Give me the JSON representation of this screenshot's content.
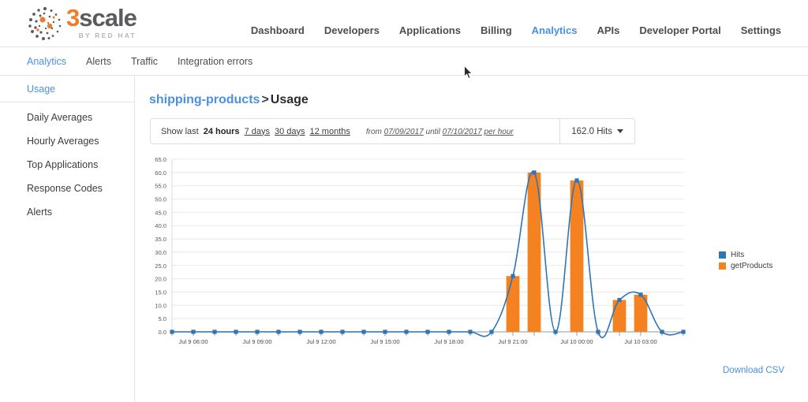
{
  "brand": {
    "name_prefix": "3",
    "name_rest": "scale",
    "tagline": "BY RED HAT",
    "logo_icon": "3scale-dots-logo"
  },
  "mainnav": {
    "items": [
      {
        "label": "Dashboard",
        "active": false
      },
      {
        "label": "Developers",
        "active": false
      },
      {
        "label": "Applications",
        "active": false
      },
      {
        "label": "Billing",
        "active": false
      },
      {
        "label": "Analytics",
        "active": true
      },
      {
        "label": "APIs",
        "active": false
      },
      {
        "label": "Developer Portal",
        "active": false
      },
      {
        "label": "Settings",
        "active": false
      }
    ]
  },
  "subnav": {
    "items": [
      {
        "label": "Analytics",
        "active": true
      },
      {
        "label": "Alerts",
        "active": false
      },
      {
        "label": "Traffic",
        "active": false
      },
      {
        "label": "Integration errors",
        "active": false
      }
    ]
  },
  "sidebar": {
    "top_item": {
      "label": "Usage",
      "active": true
    },
    "items": [
      {
        "label": "Daily Averages"
      },
      {
        "label": "Hourly Averages"
      },
      {
        "label": "Top Applications"
      },
      {
        "label": "Response Codes"
      },
      {
        "label": "Alerts"
      }
    ]
  },
  "breadcrumb": {
    "service": "shipping-products",
    "separator": ">",
    "current": "Usage"
  },
  "toolbar": {
    "show_last_label": "Show last",
    "ranges": [
      {
        "label": "24 hours",
        "selected": true
      },
      {
        "label": "7 days",
        "selected": false
      },
      {
        "label": "30 days",
        "selected": false
      },
      {
        "label": "12 months",
        "selected": false
      }
    ],
    "from_label": "from",
    "from_date": "07/09/2017",
    "until_label": "until",
    "until_date": "07/10/2017",
    "granularity": "per hour",
    "metric_value": "162.0 Hits",
    "metric_caret_icon": "chevron-down-icon"
  },
  "download": {
    "label": "Download CSV"
  },
  "colors": {
    "accent_blue": "#4a90e2",
    "series_hits": "#2e75b6",
    "series_getproducts": "#f58220",
    "brand_orange": "#f07c29",
    "grid": "#e8e8e8",
    "axis": "#b0b0b0"
  },
  "chart_data": {
    "type": "bar",
    "title": "",
    "xlabel": "",
    "ylabel": "",
    "ylim": [
      0,
      65
    ],
    "grid": true,
    "legend_position": "right",
    "y_ticks": [
      "0.0",
      "5.0",
      "10.0",
      "15.0",
      "20.0",
      "25.0",
      "30.0",
      "35.0",
      "40.0",
      "45.0",
      "50.0",
      "55.0",
      "60.0",
      "65.0"
    ],
    "x_tick_labels": [
      "Jul 9 06:00",
      "Jul 9 09:00",
      "Jul 9 12:00",
      "Jul 9 15:00",
      "Jul 9 18:00",
      "Jul 9 21:00",
      "Jul 10 00:00",
      "Jul 10 03:00"
    ],
    "x_tick_indices": [
      1,
      4,
      7,
      10,
      13,
      16,
      19,
      22
    ],
    "x": [
      "Jul 9 05:00",
      "Jul 9 06:00",
      "Jul 9 07:00",
      "Jul 9 08:00",
      "Jul 9 09:00",
      "Jul 9 10:00",
      "Jul 9 11:00",
      "Jul 9 12:00",
      "Jul 9 13:00",
      "Jul 9 14:00",
      "Jul 9 15:00",
      "Jul 9 16:00",
      "Jul 9 17:00",
      "Jul 9 18:00",
      "Jul 9 19:00",
      "Jul 9 20:00",
      "Jul 9 21:00",
      "Jul 9 22:00",
      "Jul 9 23:00",
      "Jul 10 00:00",
      "Jul 10 01:00",
      "Jul 10 02:00",
      "Jul 10 03:00",
      "Jul 10 04:00",
      "Jul 10 05:00"
    ],
    "series": [
      {
        "name": "Hits",
        "type": "line",
        "color": "#2e75b6",
        "values": [
          0,
          0,
          0,
          0,
          0,
          0,
          0,
          0,
          0,
          0,
          0,
          0,
          0,
          0,
          0,
          0,
          21,
          60,
          0,
          57,
          0,
          12,
          14,
          0,
          0
        ]
      },
      {
        "name": "getProducts",
        "type": "bar",
        "color": "#f58220",
        "values": [
          0,
          0,
          0,
          0,
          0,
          0,
          0,
          0,
          0,
          0,
          0,
          0,
          0,
          0,
          0,
          0,
          21,
          60,
          0,
          57,
          0,
          12,
          14,
          0,
          0
        ]
      }
    ]
  }
}
